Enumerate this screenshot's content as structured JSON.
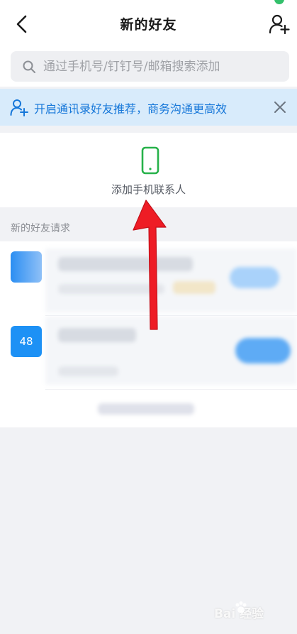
{
  "header": {
    "title": "新的好友",
    "back_icon": "chevron-left-icon",
    "add_icon": "add-person-icon"
  },
  "search": {
    "placeholder": "通过手机号/钉钉号/邮箱搜索添加",
    "icon": "search-icon"
  },
  "banner": {
    "text": "开启通讯录好友推荐，商务沟通更高效",
    "icon": "person-plus-icon",
    "close_icon": "close-icon"
  },
  "contacts": {
    "label": "添加手机联系人",
    "icon": "phone-icon"
  },
  "requests": {
    "section_label": "新的好友请求",
    "items": [
      {
        "avatar_text": ""
      },
      {
        "avatar_text": "48"
      }
    ]
  },
  "watermark": {
    "text": "Bai  经验"
  },
  "colors": {
    "accent": "#1677d9",
    "banner_bg": "#d8ebfb",
    "phone_green": "#27b24a",
    "arrow_red": "#ee1c25",
    "avatar_blue": "#1d91f5"
  }
}
